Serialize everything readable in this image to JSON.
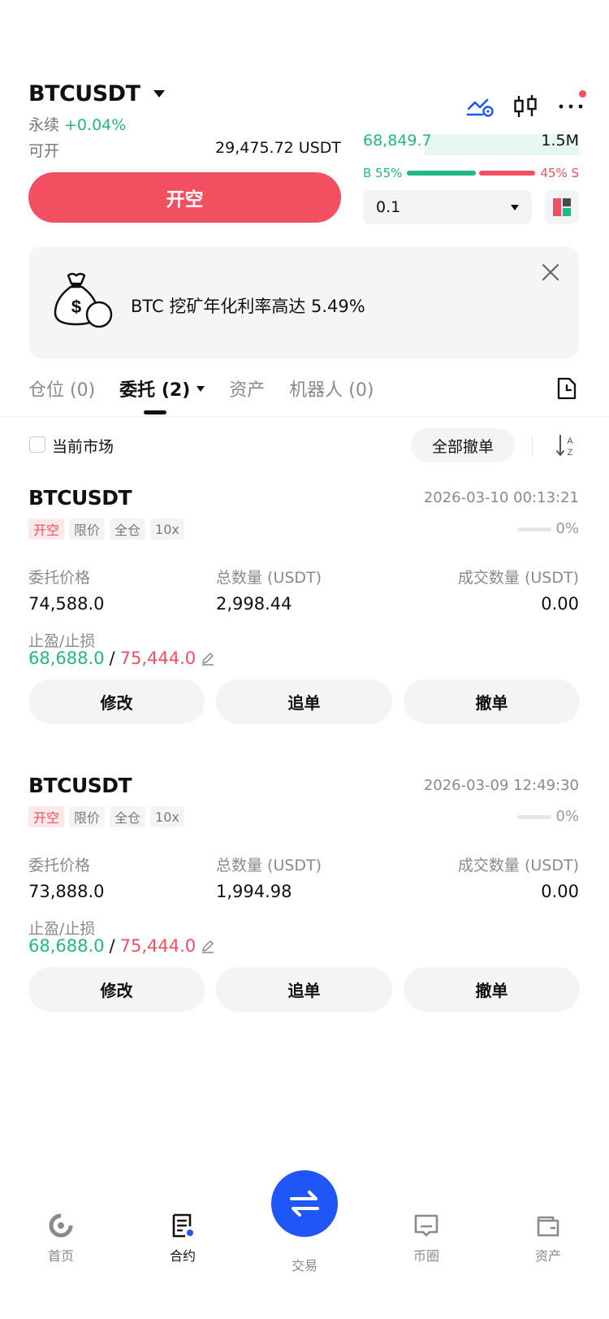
{
  "header": {
    "symbol": "BTCUSDT",
    "contract_type": "永续",
    "change": "+0.04%",
    "available_label": "可开",
    "available_value": "29,475.72 USDT",
    "short_button": "开空"
  },
  "orderbook": {
    "price": "68,849.7",
    "volume": "1.5M",
    "buy_ratio": "B 55%",
    "sell_ratio": "45% S",
    "buy_fraction": 0.55,
    "quantity": "0.1"
  },
  "banner": {
    "text": "BTC 挖矿年化利率高达 5.49%"
  },
  "tabs": [
    {
      "label": "仓位 (0)"
    },
    {
      "label": "委托 (2)"
    },
    {
      "label": "资产"
    },
    {
      "label": "机器人 (0)"
    }
  ],
  "filter": {
    "current_market_label": "当前市场",
    "cancel_all_label": "全部撤单"
  },
  "orders": [
    {
      "symbol": "BTCUSDT",
      "time": "2026-03-10 00:13:21",
      "tags": [
        "开空",
        "限价",
        "全仓",
        "10x"
      ],
      "progress_pct": "0%",
      "progress": 0,
      "price_label": "委托价格",
      "price": "74,588.0",
      "amount_label": "总数量 (USDT)",
      "amount": "2,998.44",
      "filled_label": "成交数量 (USDT)",
      "filled": "0.00",
      "tpsl_label": "止盈/止损",
      "tp": "68,688.0",
      "sl": "75,444.0",
      "buttons": {
        "modify": "修改",
        "chase": "追单",
        "cancel": "撤单"
      }
    },
    {
      "symbol": "BTCUSDT",
      "time": "2026-03-09 12:49:30",
      "tags": [
        "开空",
        "限价",
        "全仓",
        "10x"
      ],
      "progress_pct": "0%",
      "progress": 0,
      "price_label": "委托价格",
      "price": "73,888.0",
      "amount_label": "总数量 (USDT)",
      "amount": "1,994.98",
      "filled_label": "成交数量 (USDT)",
      "filled": "0.00",
      "tpsl_label": "止盈/止损",
      "tp": "68,688.0",
      "sl": "75,444.0",
      "buttons": {
        "modify": "修改",
        "chase": "追单",
        "cancel": "撤单"
      }
    }
  ],
  "nav": {
    "home": "首页",
    "contract": "合约",
    "trade": "交易",
    "circle": "币圈",
    "assets": "资产"
  },
  "colors": {
    "green": "#21b981",
    "red": "#f24f60",
    "blue": "#1f56f7"
  }
}
